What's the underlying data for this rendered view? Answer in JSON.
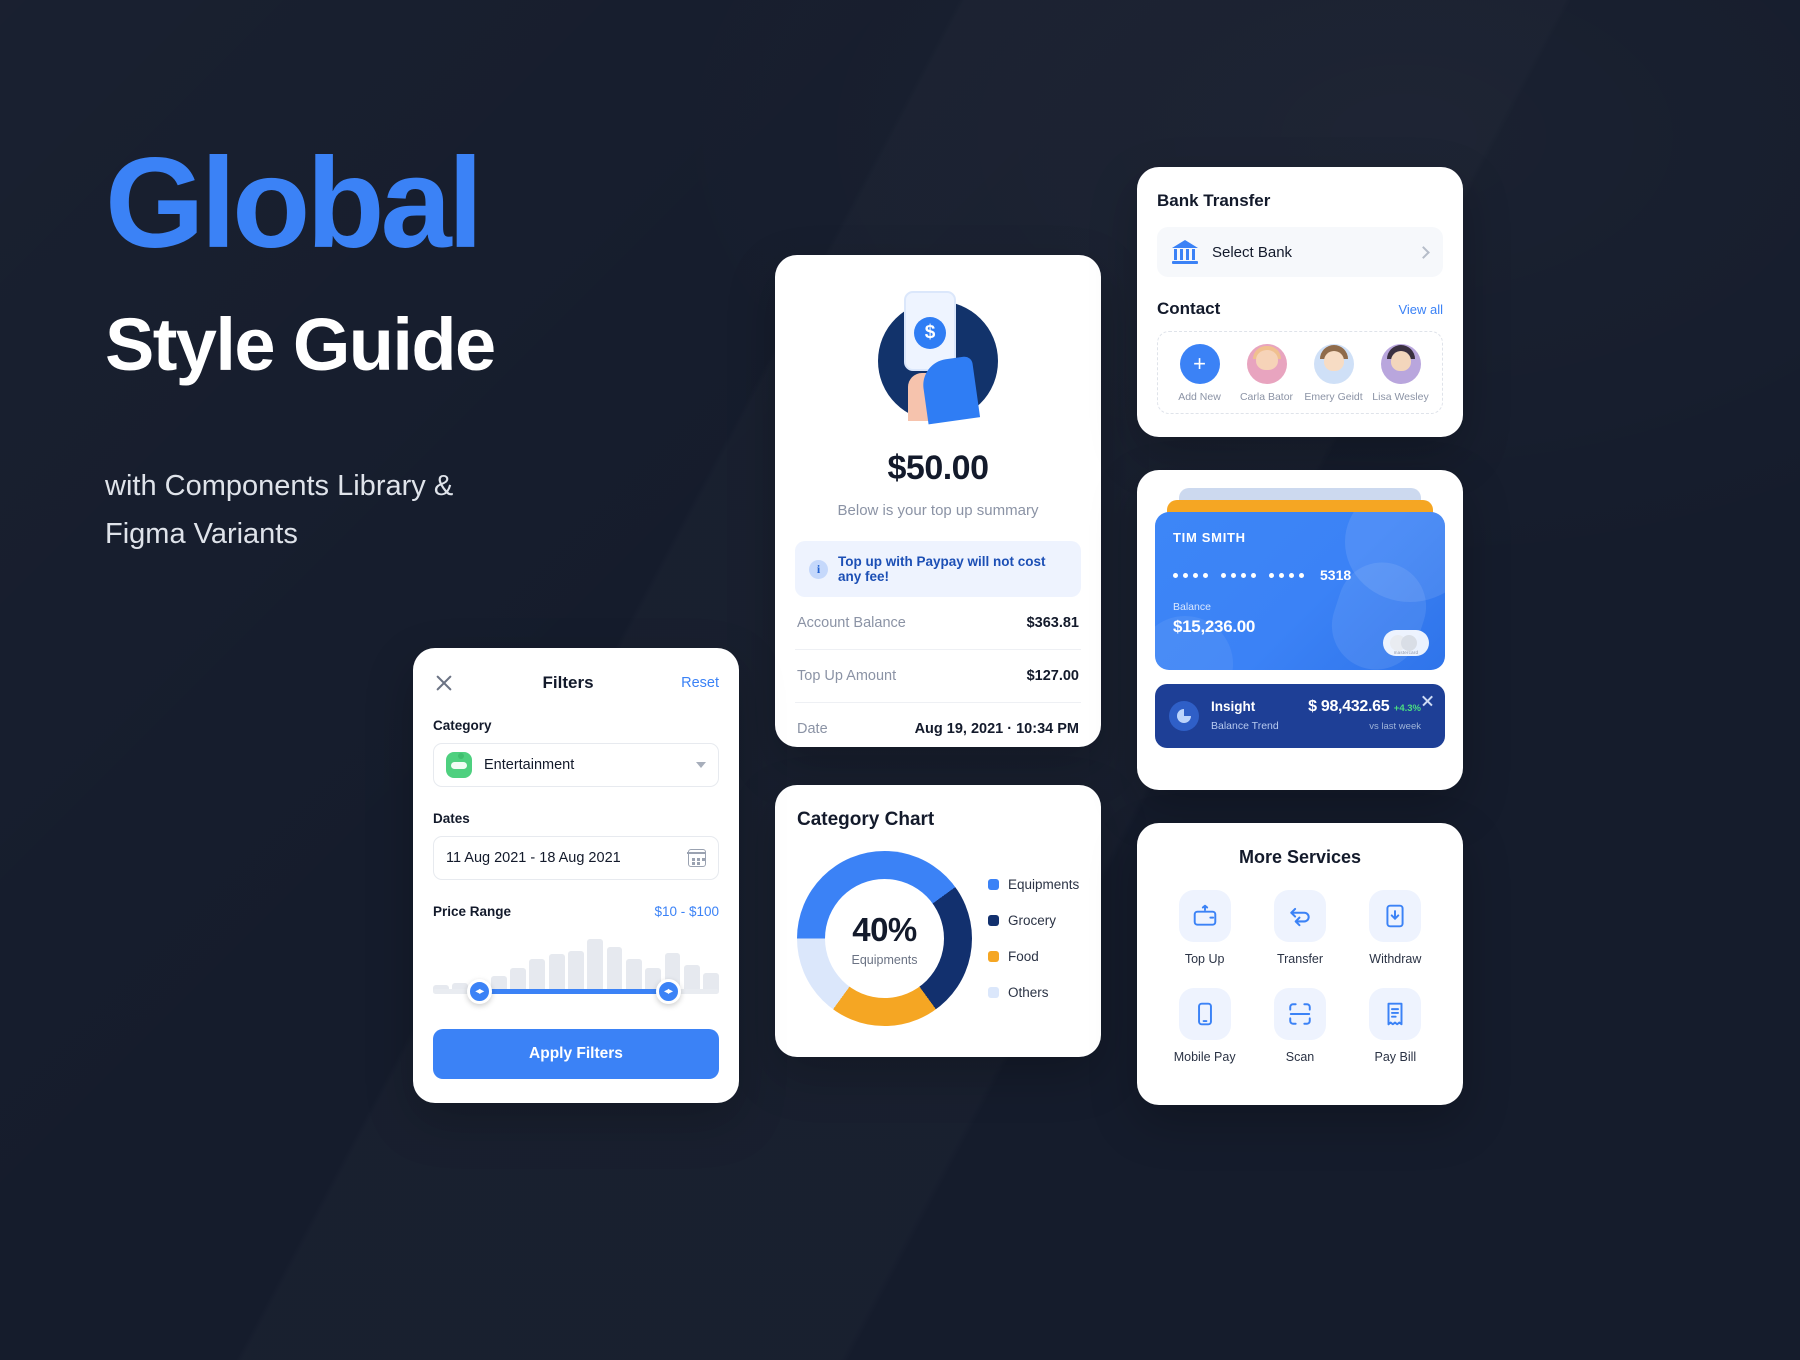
{
  "hero": {
    "title_accent": "Global",
    "title_main": "Style Guide",
    "subtitle_line1": "with Components Library &",
    "subtitle_line2": "Figma Variants",
    "accent_color": "#3b82f6",
    "background_color": "#151c2c"
  },
  "topup": {
    "amount": "$50.00",
    "subtitle": "Below is your top up summary",
    "notice_icon": "info-icon",
    "notice": "Top up with Paypay will not cost any fee!",
    "rows": [
      {
        "label": "Account Balance",
        "value": "$363.81"
      },
      {
        "label": "Top Up Amount",
        "value": "$127.00"
      },
      {
        "label": "Date",
        "value": "Aug 19, 2021 · 10:34 PM"
      }
    ]
  },
  "chart_data": {
    "type": "pie",
    "title": "Category Chart",
    "center_value": "40%",
    "center_label": "Equipments",
    "categories": [
      "Equipments",
      "Grocery",
      "Food",
      "Others"
    ],
    "values": [
      40,
      25,
      20,
      15
    ],
    "colors": [
      "#3b82f6",
      "#12306e",
      "#f5a623",
      "#dbe7fb"
    ],
    "legend_position": "right",
    "grid": false,
    "xlabel": "",
    "ylabel": ""
  },
  "filters": {
    "close_icon": "close-icon",
    "title": "Filters",
    "reset_label": "Reset",
    "category_label": "Category",
    "category_icon": "game-controller-icon",
    "category_value": "Entertainment",
    "dropdown_icon": "chevron-down-icon",
    "dates_label": "Dates",
    "dates_value": "11 Aug 2021 - 18 Aug 2021",
    "calendar_icon": "calendar-icon",
    "price_label": "Price Range",
    "price_value": "$10 - $100",
    "histogram": [
      8,
      10,
      14,
      20,
      30,
      42,
      48,
      52,
      68,
      58,
      42,
      30,
      50,
      34,
      24
    ],
    "slider_min_pct": 16,
    "slider_max_pct": 82,
    "apply_label": "Apply Filters"
  },
  "bank": {
    "title": "Bank Transfer",
    "bank_icon": "bank-icon",
    "select_bank_label": "Select Bank",
    "chevron_icon": "chevron-right-icon",
    "contact_label": "Contact",
    "view_all_label": "View all",
    "contacts": [
      {
        "name": "Add New",
        "avatar": "plus-icon"
      },
      {
        "name": "Carla Bator",
        "avatar": "avatar-carla"
      },
      {
        "name": "Emery Geidt",
        "avatar": "avatar-emery"
      },
      {
        "name": "Lisa Wesley",
        "avatar": "avatar-lisa"
      }
    ]
  },
  "wallet": {
    "card_holder": "TIM SMITH",
    "card_last4": "5318",
    "balance_label": "Balance",
    "balance_value": "$15,236.00",
    "network_logo": "mastercard",
    "insight": {
      "title": "Insight",
      "subtitle": "Balance Trend",
      "amount": "$ 98,432.65",
      "delta": "+4.3%",
      "delta_suffix": "vs last week",
      "close_icon": "close-icon"
    }
  },
  "services": {
    "title": "More Services",
    "items": [
      {
        "label": "Top Up",
        "icon": "wallet-topup-icon"
      },
      {
        "label": "Transfer",
        "icon": "transfer-arrows-icon"
      },
      {
        "label": "Withdraw",
        "icon": "withdraw-icon"
      },
      {
        "label": "Mobile Pay",
        "icon": "mobile-phone-icon"
      },
      {
        "label": "Scan",
        "icon": "scan-icon"
      },
      {
        "label": "Pay Bill",
        "icon": "receipt-icon"
      }
    ]
  }
}
